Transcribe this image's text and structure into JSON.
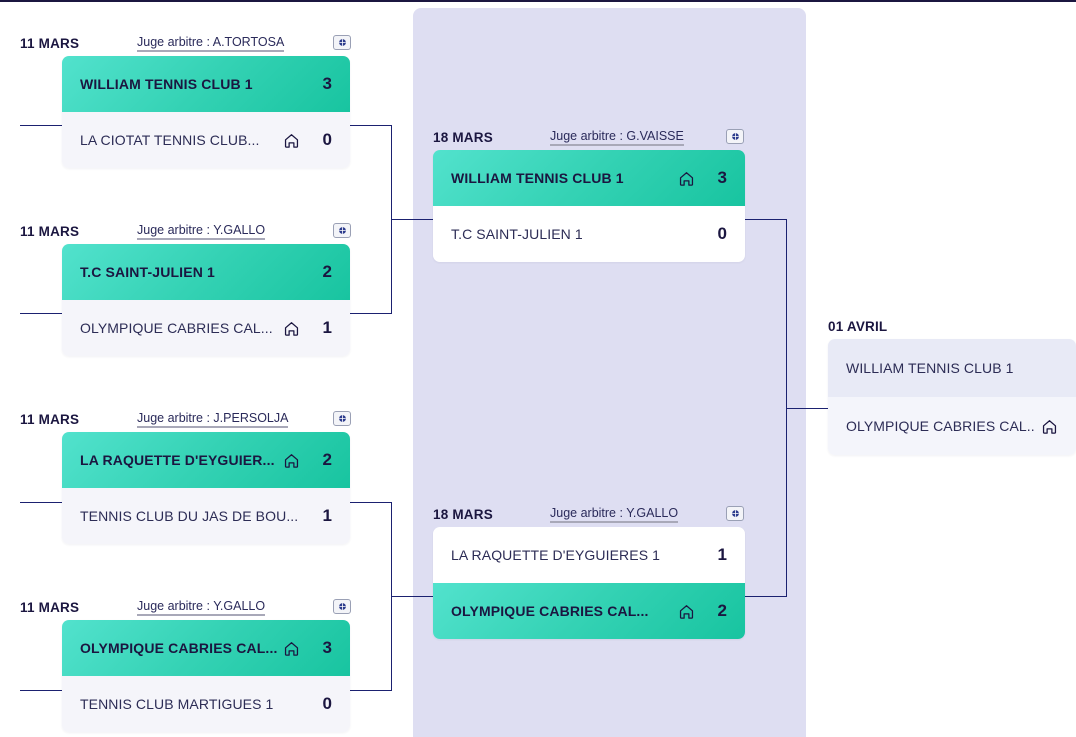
{
  "theme": {
    "accent_win": "#34d2b4",
    "panel_bg": "#dedef2",
    "line": "#1b2170",
    "text": "#1b1640"
  },
  "icons": {
    "home": "home-icon",
    "media": "media-thumbnail-icon"
  },
  "rounds": [
    {
      "id": "quarter-finals",
      "matches": [
        {
          "date": "11 MARS",
          "referee": "Juge arbitre : A.TORTOSA",
          "top": {
            "team": "WILLIAM TENNIS CLUB 1",
            "score": "3",
            "home": false,
            "winner": true
          },
          "bottom": {
            "team": "LA CIOTAT TENNIS CLUB...",
            "score": "0",
            "home": true,
            "winner": false
          }
        },
        {
          "date": "11 MARS",
          "referee": "Juge arbitre : Y.GALLO",
          "top": {
            "team": "T.C SAINT-JULIEN 1",
            "score": "2",
            "home": false,
            "winner": true
          },
          "bottom": {
            "team": "OLYMPIQUE CABRIES CAL...",
            "score": "1",
            "home": true,
            "winner": false
          }
        },
        {
          "date": "11 MARS",
          "referee": "Juge arbitre : J.PERSOLJA",
          "top": {
            "team": "LA RAQUETTE D'EYGUIER...",
            "score": "2",
            "home": true,
            "winner": true
          },
          "bottom": {
            "team": "TENNIS CLUB DU JAS DE BOU...",
            "score": "1",
            "home": false,
            "winner": false
          }
        },
        {
          "date": "11 MARS",
          "referee": "Juge arbitre : Y.GALLO",
          "top": {
            "team": "OLYMPIQUE CABRIES CAL...",
            "score": "3",
            "home": true,
            "winner": true
          },
          "bottom": {
            "team": "TENNIS CLUB MARTIGUES 1",
            "score": "0",
            "home": false,
            "winner": false
          }
        }
      ]
    },
    {
      "id": "semi-finals",
      "matches": [
        {
          "date": "18 MARS",
          "referee": "Juge arbitre : G.VAISSE",
          "top": {
            "team": "WILLIAM TENNIS CLUB 1",
            "score": "3",
            "home": true,
            "winner": true
          },
          "bottom": {
            "team": "T.C SAINT-JULIEN 1",
            "score": "0",
            "home": false,
            "winner": false
          }
        },
        {
          "date": "18 MARS",
          "referee": "Juge arbitre : Y.GALLO",
          "top": {
            "team": "LA RAQUETTE D'EYGUIERES 1",
            "score": "1",
            "home": false,
            "winner": false
          },
          "bottom": {
            "team": "OLYMPIQUE CABRIES CAL...",
            "score": "2",
            "home": true,
            "winner": true
          }
        }
      ]
    },
    {
      "id": "final",
      "matches": [
        {
          "date": "01 AVRIL",
          "referee": "",
          "top": {
            "team": "WILLIAM TENNIS CLUB 1",
            "score": "",
            "home": false,
            "winner": false
          },
          "bottom": {
            "team": "OLYMPIQUE CABRIES CAL...",
            "score": "",
            "home": true,
            "winner": false
          }
        }
      ]
    }
  ]
}
